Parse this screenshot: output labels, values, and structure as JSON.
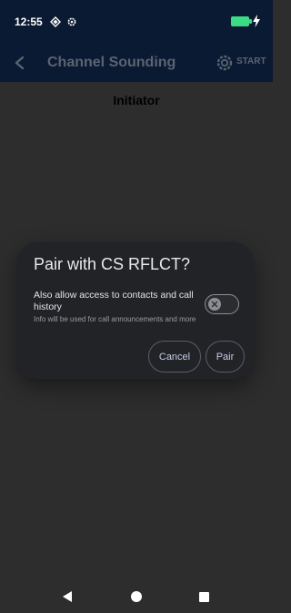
{
  "status_bar": {
    "time": "12:55",
    "icons": [
      "signal-diamond-icon",
      "settings-gear-icon",
      "battery-charging-icon"
    ],
    "battery_color": "#3ddc84"
  },
  "app_bar": {
    "title": "Channel Sounding",
    "start_label": "START"
  },
  "content": {
    "heading": "Initiator"
  },
  "dialog": {
    "title": "Pair with CS RFLCT?",
    "option_label": "Also allow access to contacts and call history",
    "option_sub": "Info will be used for call announcements and more",
    "toggle_on": false,
    "cancel_label": "Cancel",
    "pair_label": "Pair"
  },
  "nav_bar": {
    "icons": [
      "back-triangle-icon",
      "home-circle-icon",
      "recents-square-icon"
    ]
  }
}
